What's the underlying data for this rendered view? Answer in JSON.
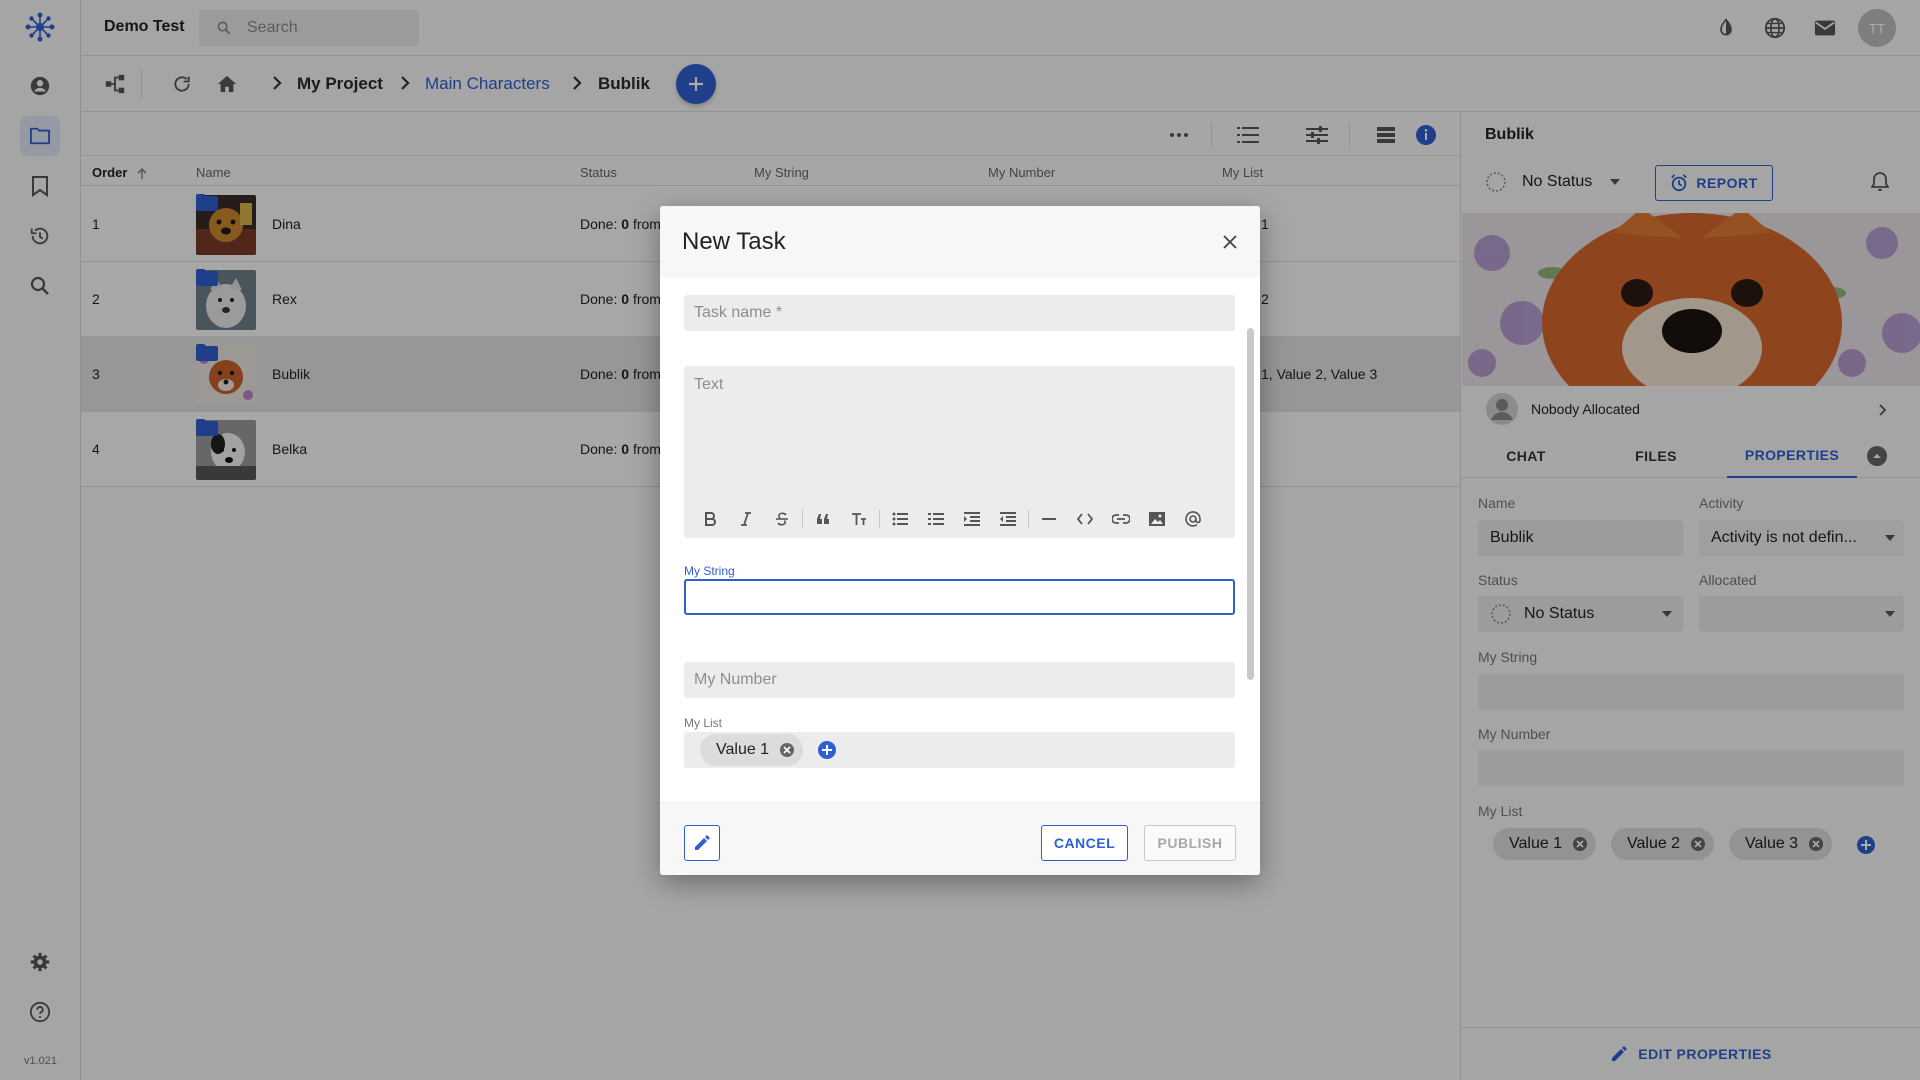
{
  "app": {
    "title": "Demo Test",
    "version": "v1.021"
  },
  "search": {
    "placeholder": "Search"
  },
  "user": {
    "initials": "TT"
  },
  "breadcrumb": {
    "items": [
      "My Project",
      "Main Characters",
      "Bublik"
    ]
  },
  "table": {
    "columns": [
      "Order",
      "Name",
      "Status",
      "My String",
      "My Number",
      "My List"
    ],
    "rows": [
      {
        "order": "1",
        "name": "Dina",
        "status_prefix": "Done:",
        "status_count": "0",
        "status_suffix": "from",
        "list": "1"
      },
      {
        "order": "2",
        "name": "Rex",
        "status_prefix": "Done:",
        "status_count": "0",
        "status_suffix": "from",
        "list": "2"
      },
      {
        "order": "3",
        "name": "Bublik",
        "status_prefix": "Done:",
        "status_count": "0",
        "status_suffix": "from",
        "list": "1, Value 2, Value 3"
      },
      {
        "order": "4",
        "name": "Belka",
        "status_prefix": "Done:",
        "status_count": "0",
        "status_suffix": "from",
        "list": ""
      }
    ]
  },
  "panel": {
    "title": "Bublik",
    "status": "No Status",
    "report_label": "REPORT",
    "allocated": "Nobody Allocated",
    "tabs": [
      "CHAT",
      "FILES",
      "PROPERTIES"
    ],
    "props": {
      "name_label": "Name",
      "name_value": "Bublik",
      "activity_label": "Activity",
      "activity_value": "Activity is not defin...",
      "status_label": "Status",
      "status_value": "No Status",
      "allocated_label": "Allocated",
      "allocated_value": "",
      "mystring_label": "My String",
      "mystring_value": "",
      "mynumber_label": "My Number",
      "mynumber_value": "",
      "mylist_label": "My List",
      "mylist_values": [
        "Value 1",
        "Value 2",
        "Value 3"
      ]
    },
    "edit_label": "EDIT PROPERTIES"
  },
  "dialog": {
    "title": "New Task",
    "task_name_placeholder": "Task name *",
    "text_placeholder": "Text",
    "mystring_label": "My String",
    "mystring_value": "",
    "mynumber_placeholder": "My Number",
    "mylist_label": "My List",
    "mylist_values": [
      "Value 1"
    ],
    "cancel_label": "CANCEL",
    "publish_label": "PUBLISH"
  },
  "colors": {
    "accent": "#2f5fd0",
    "overlay": "rgba(0,0,0,0.33)"
  }
}
